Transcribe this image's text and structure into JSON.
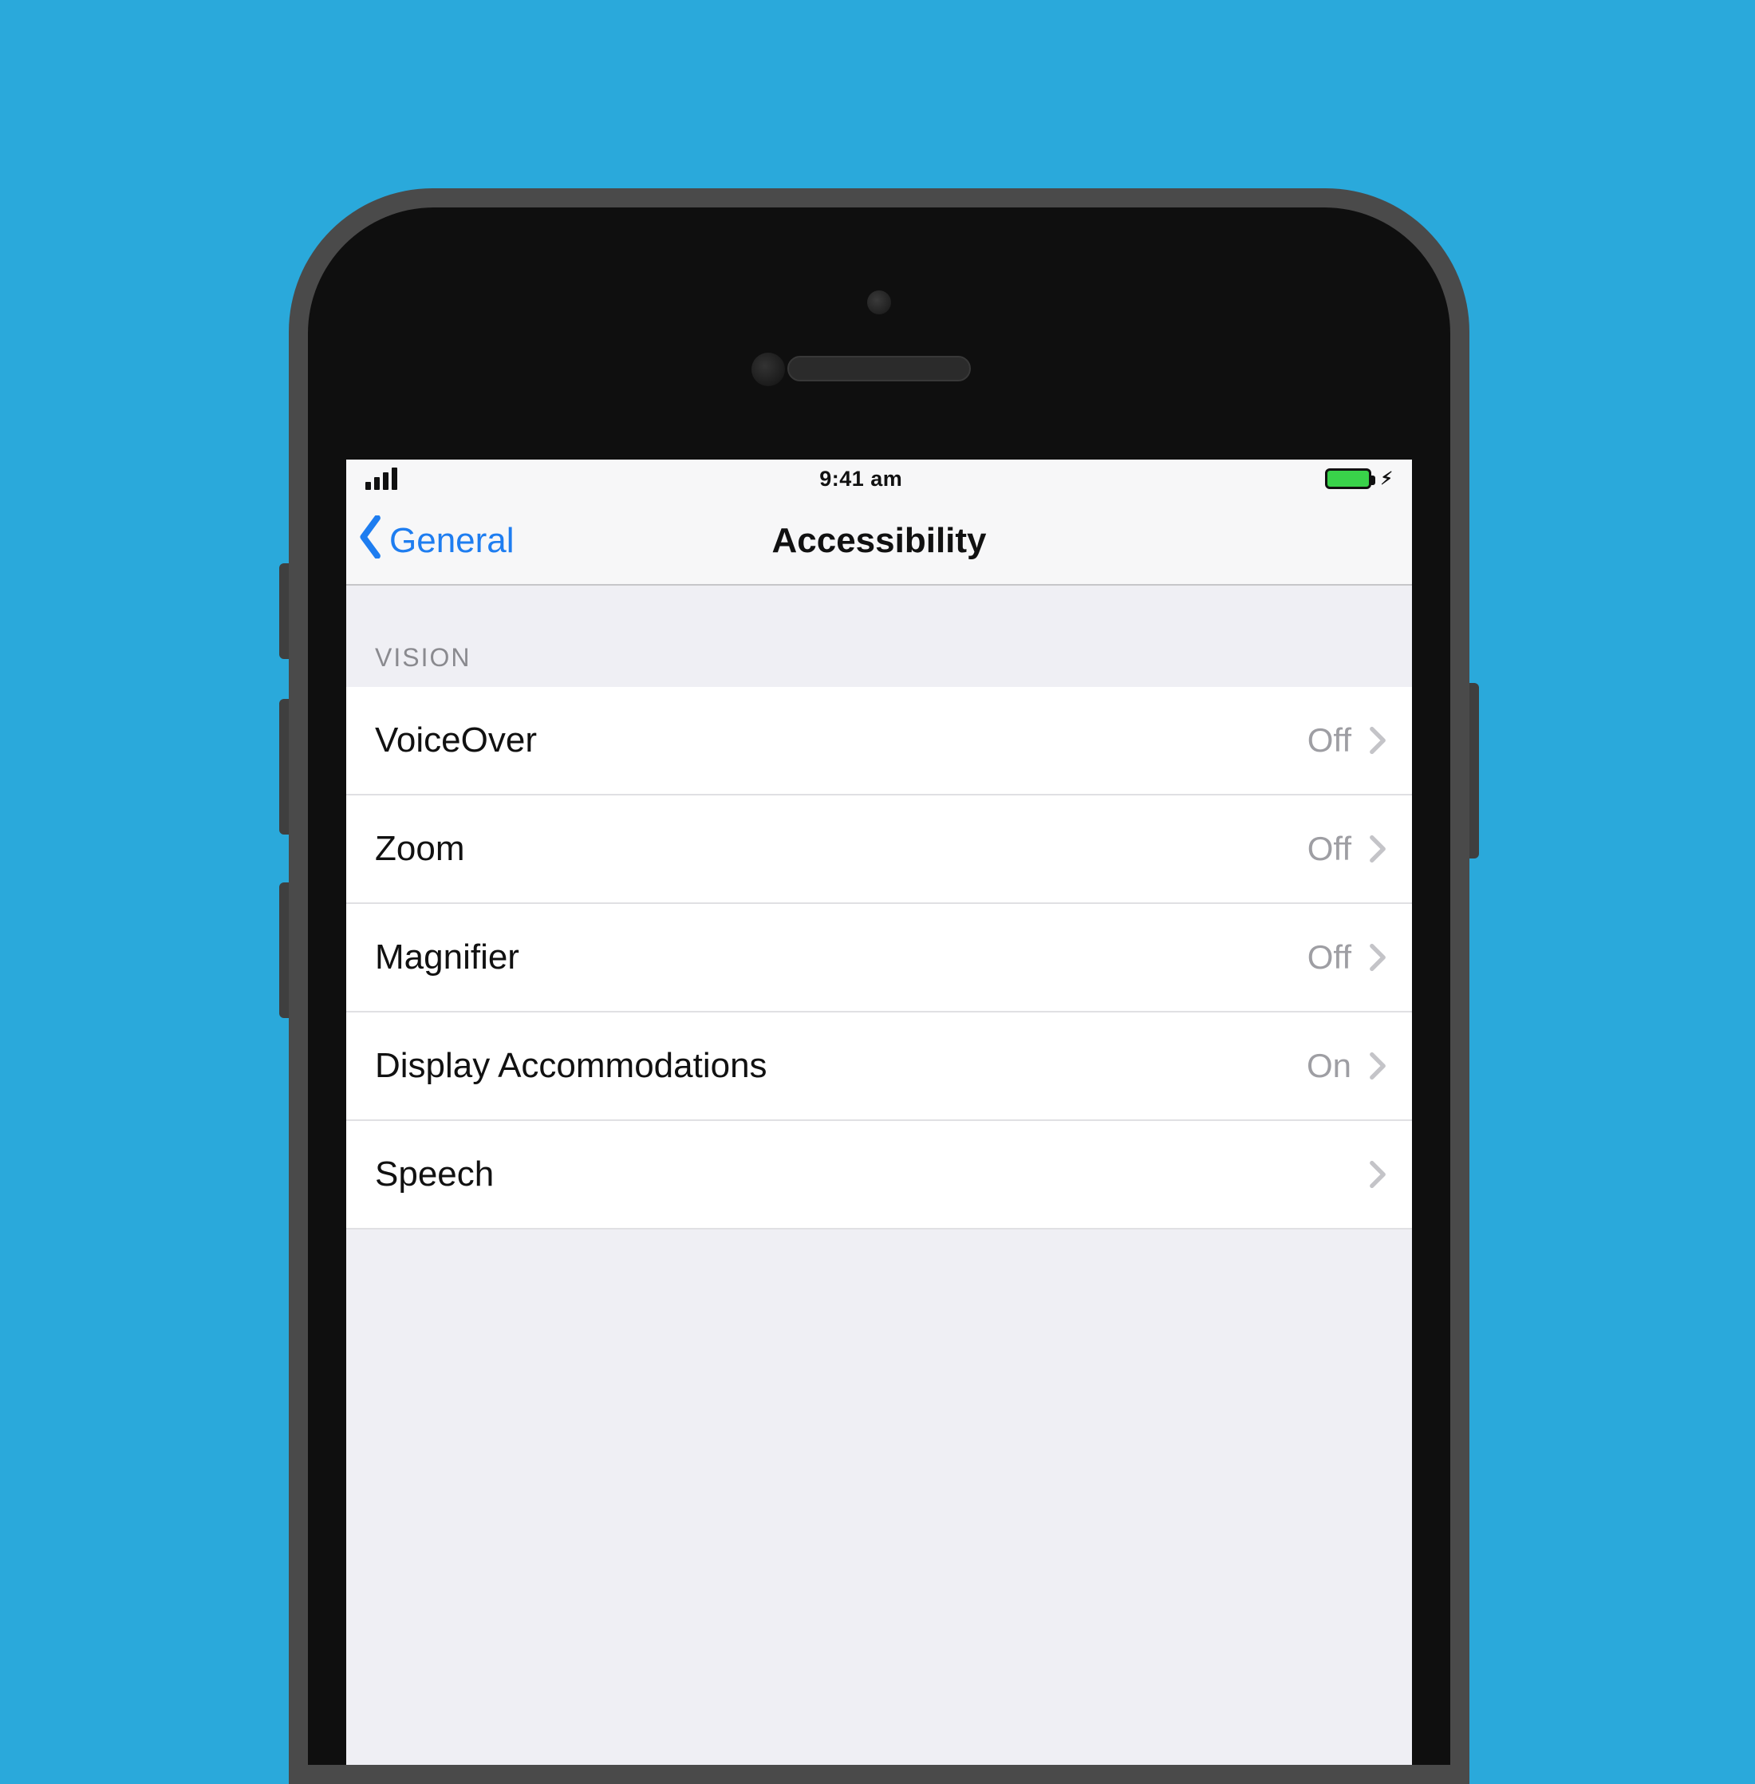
{
  "statusBar": {
    "time": "9:41 am"
  },
  "navbar": {
    "back": "General",
    "title": "Accessibility"
  },
  "section": {
    "header": "VISION",
    "rows": [
      {
        "label": "VoiceOver",
        "value": "Off"
      },
      {
        "label": "Zoom",
        "value": "Off"
      },
      {
        "label": "Magnifier",
        "value": "Off"
      },
      {
        "label": "Display Accommodations",
        "value": "On"
      },
      {
        "label": "Speech",
        "value": ""
      }
    ]
  }
}
